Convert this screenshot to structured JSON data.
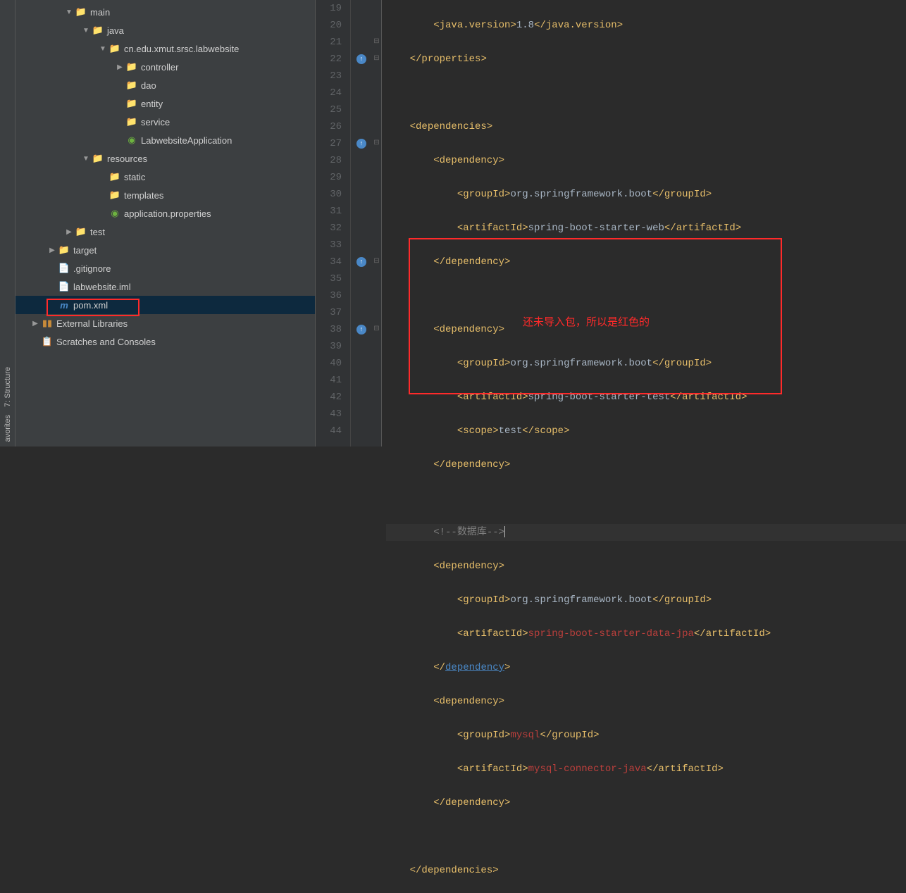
{
  "leftTabs": {
    "structure": "7: Structure",
    "favorites": "avorites"
  },
  "tree": {
    "main": "main",
    "java": "java",
    "package": "cn.edu.xmut.srsc.labwebsite",
    "controller": "controller",
    "dao": "dao",
    "entity": "entity",
    "service": "service",
    "appClass": "LabwebsiteApplication",
    "resources": "resources",
    "static": "static",
    "templates": "templates",
    "appProps": "application.properties",
    "test": "test",
    "target": "target",
    "gitignore": ".gitignore",
    "iml": "labwebsite.iml",
    "pom": "pom.xml",
    "extLib": "External Libraries",
    "scratches": "Scratches and Consoles"
  },
  "lineNumbers": [
    "19",
    "20",
    "21",
    "22",
    "23",
    "24",
    "25",
    "26",
    "27",
    "28",
    "29",
    "30",
    "31",
    "32",
    "33",
    "34",
    "35",
    "36",
    "37",
    "38",
    "39",
    "40",
    "41",
    "42",
    "43",
    "44"
  ],
  "code": {
    "l19_tag": "java.version",
    "l19_val": "1.8",
    "l20": "properties",
    "l21": "dependencies",
    "l22": "dependency",
    "l23_tag": "groupId",
    "l23_val": "org.springframework.boot",
    "l24_tag": "artifactId",
    "l24_val": "spring-boot-starter-web",
    "l25": "dependency",
    "l27": "dependency",
    "l28_tag": "groupId",
    "l28_val": "org.springframework.boot",
    "l29_tag": "artifactId",
    "l29_val": "spring-boot-starter-test",
    "l30_tag": "scope",
    "l30_val": "test",
    "l31": "dependency",
    "l33_comment": "<!--数据库-->",
    "l34": "dependency",
    "l35_tag": "groupId",
    "l35_val": "org.springframework.boot",
    "l36_tag": "artifactId",
    "l36_val": "spring-boot-starter-data-jpa",
    "l37": "dependency",
    "l38": "dependency",
    "l39_tag": "groupId",
    "l39_val": "mysql",
    "l40_tag": "artifactId",
    "l40_val": "mysql-connector-java",
    "l41": "dependency",
    "l43": "dependencies"
  },
  "annotation": "还未导入包，所以是红色的"
}
